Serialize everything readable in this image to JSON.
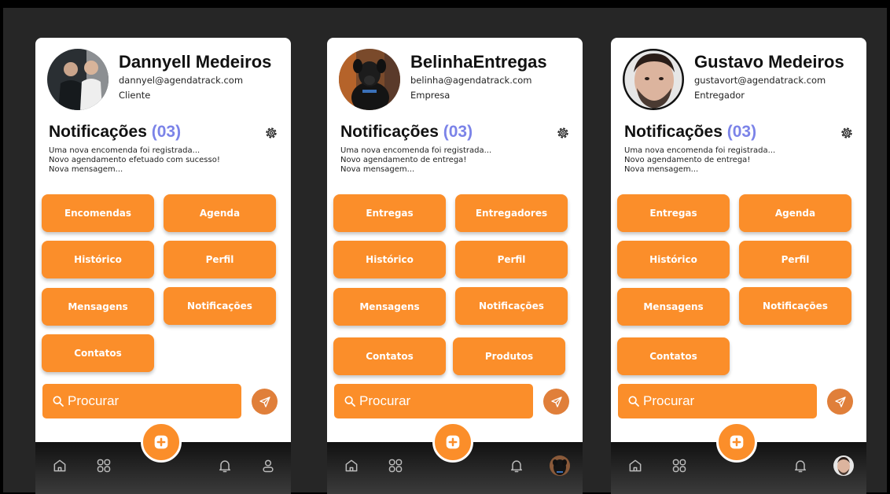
{
  "screens": [
    {
      "user": {
        "name": "Dannyell Medeiros",
        "email": "dannyel@agendatrack.com",
        "role": "Cliente",
        "avatar_icon": "user-photo"
      },
      "notifications": {
        "title": "Notificações",
        "count": "(03)",
        "items": [
          "Uma nova encomenda foi registrada...",
          "Novo agendamento efetuado com sucesso!",
          "Nova mensagem..."
        ]
      },
      "menu": [
        "Encomendas",
        "Agenda",
        "Histórico",
        "Perfil",
        "Mensagens",
        "Notificações",
        "Contatos"
      ],
      "search_placeholder": "Procurar",
      "nav": {
        "icons": [
          "home-icon",
          "grid-icon",
          "plus-icon",
          "bell-icon",
          "profile-icon"
        ]
      }
    },
    {
      "user": {
        "name": "BelinhaEntregas",
        "email": "belinha@agendatrack.com",
        "role": "Empresa",
        "avatar_icon": "dog-photo"
      },
      "notifications": {
        "title": "Notificações",
        "count": "(03)",
        "items": [
          "Uma nova encomenda foi registrada...",
          "Novo agendamento de entrega!",
          "Nova mensagem..."
        ]
      },
      "menu": [
        "Entregas",
        "Entregadores",
        "Histórico",
        "Perfil",
        "Mensagens",
        "Notificações",
        "Contatos",
        "Produtos"
      ],
      "search_placeholder": "Procurar",
      "nav": {
        "icons": [
          "home-icon",
          "grid-icon",
          "plus-icon",
          "bell-icon",
          "avatar-icon"
        ]
      }
    },
    {
      "user": {
        "name": "Gustavo Medeiros",
        "email": "gustavort@agendatrack.com",
        "role": "Entregador",
        "avatar_icon": "user-photo"
      },
      "notifications": {
        "title": "Notificações",
        "count": "(03)",
        "items": [
          "Uma nova encomenda foi registrada...",
          "Novo agendamento de entrega!",
          "Nova mensagem..."
        ]
      },
      "menu": [
        "Entregas",
        "Agenda",
        "Histórico",
        "Perfil",
        "Mensagens",
        "Notificações",
        "Contatos"
      ],
      "search_placeholder": "Procurar",
      "nav": {
        "icons": [
          "home-icon",
          "grid-icon",
          "plus-icon",
          "bell-icon",
          "avatar-icon"
        ]
      }
    }
  ],
  "colors": {
    "accent": "#fb8e2a",
    "send": "#e07f3a",
    "count": "#7b83e8",
    "nav_bg": "#1a1a1a",
    "page_bg": "#262626"
  }
}
